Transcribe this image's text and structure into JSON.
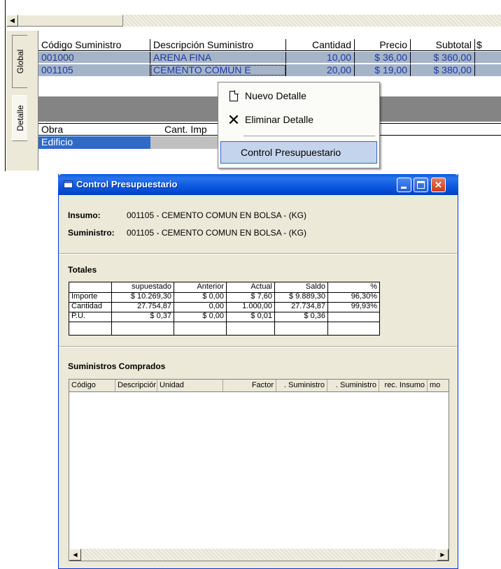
{
  "background_app": {
    "tabs": [
      "Global",
      "Detalle"
    ],
    "grid": {
      "headers": [
        "Código Suministro",
        "Descripción Suministro",
        "Cantidad",
        "Precio",
        "Subtotal",
        "$"
      ],
      "rows": [
        [
          "001000",
          "ARENA FINA",
          "10,00",
          "$ 36,00",
          "$ 360,00"
        ],
        [
          "001105",
          "CEMENTO COMUN E",
          "20,00",
          "$ 19,00",
          "$ 380,00"
        ]
      ]
    },
    "grid2": {
      "headers": [
        "Obra",
        "Cant. Imp"
      ],
      "rows": [
        [
          "Edificio",
          ""
        ]
      ]
    }
  },
  "context_menu": {
    "items": [
      {
        "label": "Nuevo Detalle",
        "icon": "new-document-icon"
      },
      {
        "label": "Eliminar Detalle",
        "icon": "delete-x-icon"
      },
      {
        "label": "Control Presupuestario",
        "icon": ""
      }
    ]
  },
  "dialog": {
    "title": "Control Presupuestario",
    "insumo_label": "Insumo:",
    "insumo_value": "001105 - CEMENTO COMUN EN BOLSA - (KG)",
    "suministro_label": "Suministro:",
    "suministro_value": "001105 - CEMENTO COMUN EN BOLSA - (KG)",
    "totales_title": "Totales",
    "totales": {
      "headers": [
        "",
        "supuestado",
        "Anterior",
        "Actual",
        "Saldo",
        "%"
      ],
      "rows": [
        [
          "Importe",
          "$ 10.269,30",
          "$ 0,00",
          "$ 7,60",
          "$ 9.889,30",
          "96,30%"
        ],
        [
          "Cantidad",
          "27.754,87",
          "0,00",
          "1.000,00",
          "27.734,87",
          "99,93%"
        ],
        [
          "P.U.",
          "$ 0,37",
          "$ 0,00",
          "$ 0,01",
          "$ 0,36",
          ""
        ]
      ]
    },
    "suministros_title": "Suministros Comprados",
    "suministros_headers": [
      "Código",
      "Descripciór",
      "Unidad",
      "Factor",
      ". Suministro",
      ". Suministro",
      "rec. Insumo",
      "mo"
    ],
    "colors": {
      "titlebar": "#0a5bdc",
      "selection": "#316ac5",
      "grid_row": "#a6b4c8"
    }
  }
}
